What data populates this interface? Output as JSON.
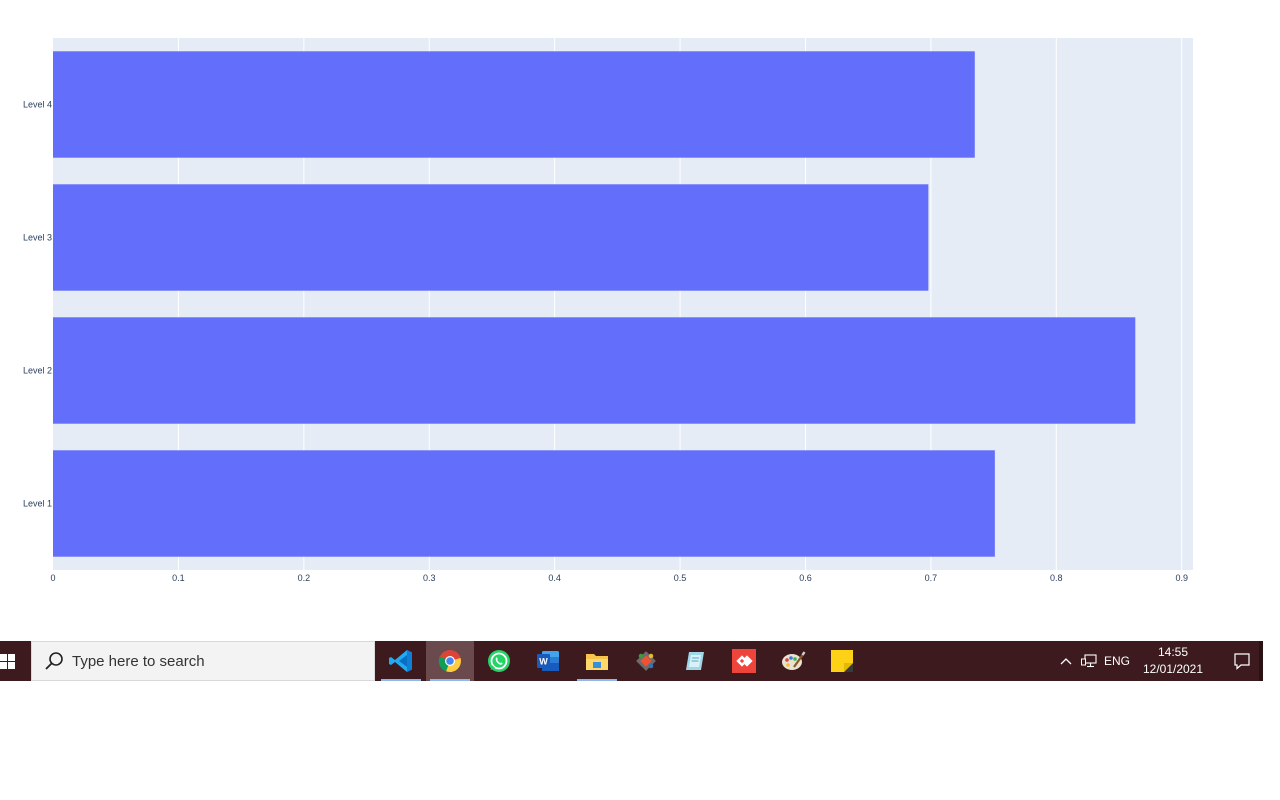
{
  "chart_data": {
    "type": "bar",
    "orientation": "horizontal",
    "categories": [
      "Level 1",
      "Level 2",
      "Level 3",
      "Level 4"
    ],
    "values": [
      0.751,
      0.863,
      0.698,
      0.735
    ],
    "xlim": [
      0,
      0.909
    ],
    "xticks": [
      "0",
      "0.1",
      "0.2",
      "0.3",
      "0.4",
      "0.5",
      "0.6",
      "0.7",
      "0.8",
      "0.9"
    ],
    "xtick_values": [
      0,
      0.1,
      0.2,
      0.3,
      0.4,
      0.5,
      0.6,
      0.7,
      0.8,
      0.9
    ],
    "grid": true,
    "bar_color": "#636efa",
    "plot_bg": "#e5ecf6",
    "title": "",
    "xlabel": "",
    "ylabel": ""
  },
  "taskbar": {
    "search_placeholder": "Type here to search",
    "apps": [
      {
        "icon": "vscode-icon",
        "active": false,
        "open": true
      },
      {
        "icon": "chrome-icon",
        "active": true,
        "open": true
      },
      {
        "icon": "whatsapp-icon",
        "active": false,
        "open": false
      },
      {
        "icon": "word-icon",
        "active": false,
        "open": false
      },
      {
        "icon": "file-explorer-icon",
        "active": false,
        "open": true
      },
      {
        "icon": "git-gui-icon",
        "active": false,
        "open": false
      },
      {
        "icon": "notes-app-icon",
        "active": false,
        "open": false
      },
      {
        "icon": "anydesk-icon",
        "active": false,
        "open": false
      },
      {
        "icon": "paint-icon",
        "active": false,
        "open": false
      },
      {
        "icon": "sticky-notes-icon",
        "active": false,
        "open": false
      }
    ],
    "tray": {
      "language": "ENG",
      "time": "14:55",
      "date": "12/01/2021"
    },
    "colors": {
      "taskbar_bg": "#3c1a1d",
      "active_app_bg": "#6a4a4d",
      "running_indicator": "#8fb8e8"
    }
  }
}
